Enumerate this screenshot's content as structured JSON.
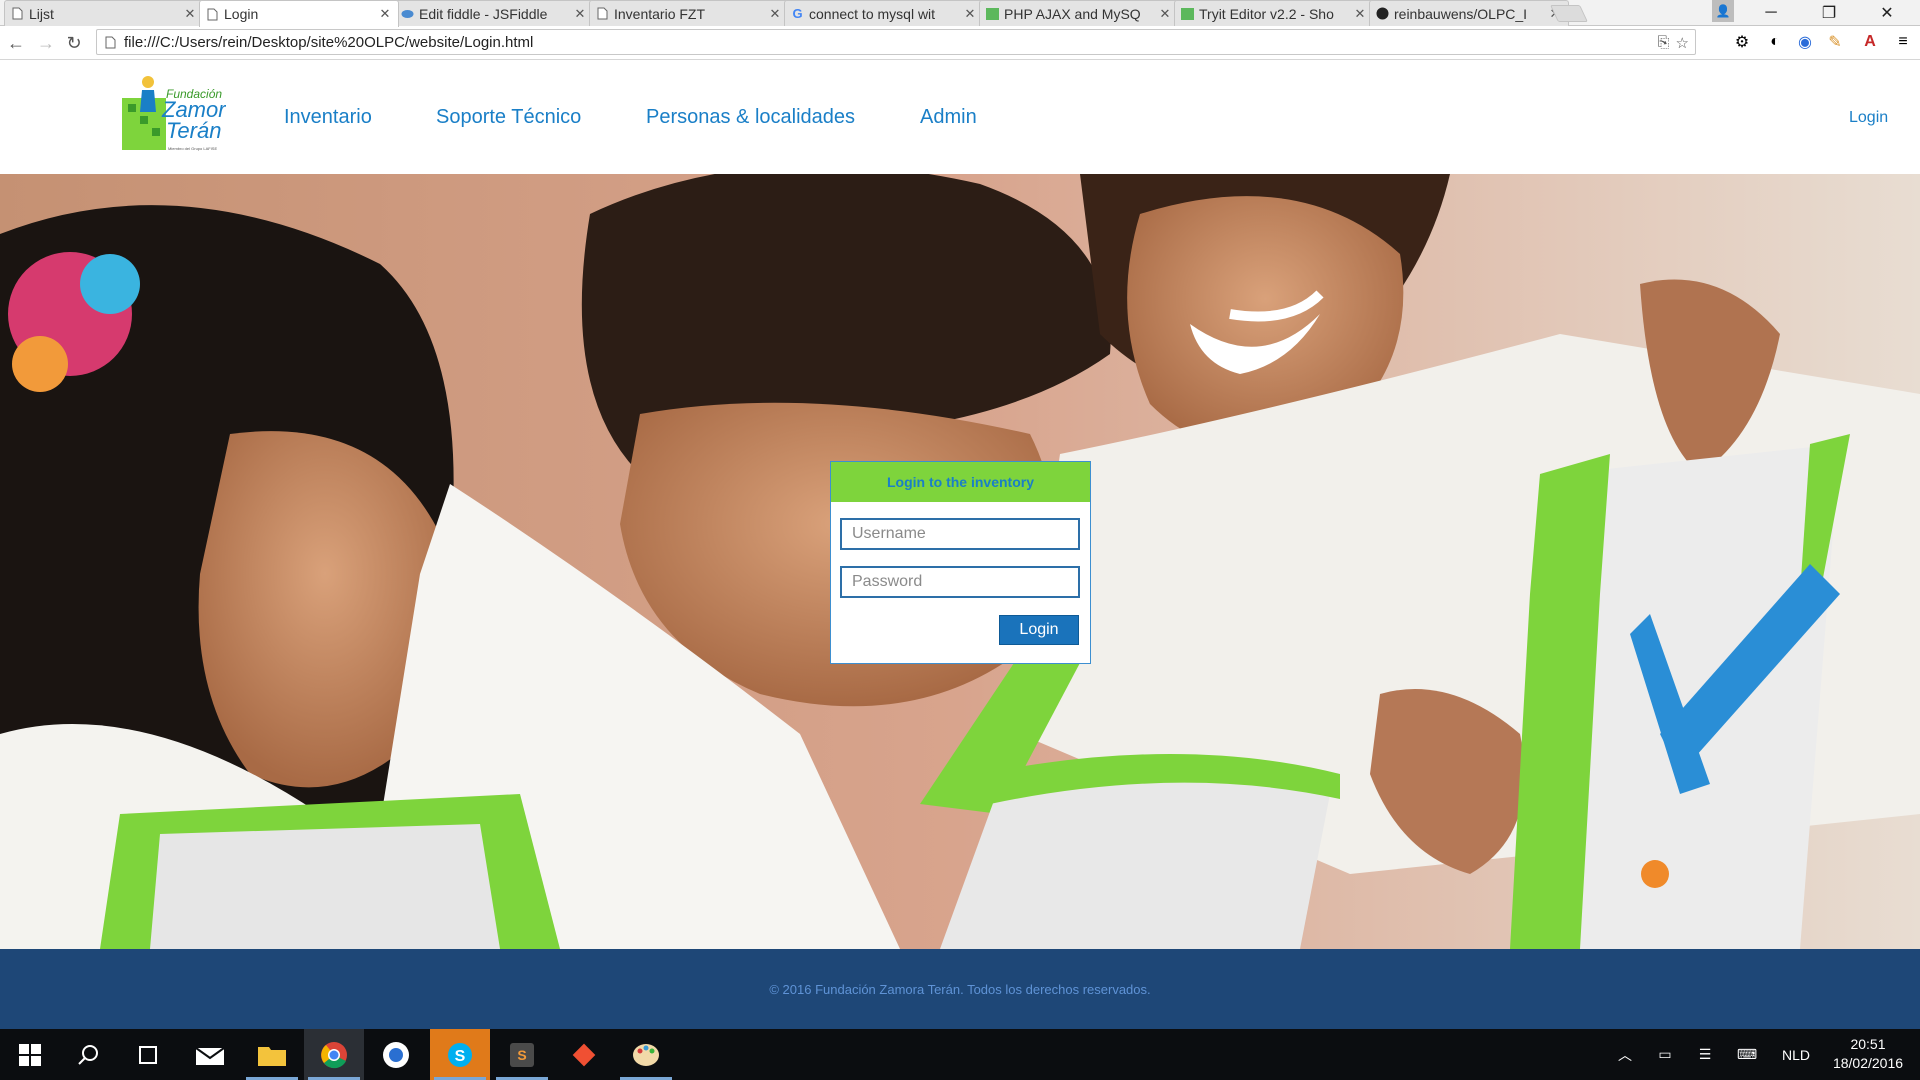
{
  "browser": {
    "tabs": [
      {
        "title": "Lijst",
        "icon": "page-icon"
      },
      {
        "title": "Login",
        "icon": "page-icon",
        "active": true
      },
      {
        "title": "Edit fiddle - JSFiddle",
        "icon": "jsfiddle-icon"
      },
      {
        "title": "Inventario FZT",
        "icon": "page-icon"
      },
      {
        "title": "connect to mysql wit",
        "icon": "google-icon"
      },
      {
        "title": "PHP AJAX and MySQ",
        "icon": "w3schools-icon"
      },
      {
        "title": "Tryit Editor v2.2 - Sho",
        "icon": "w3schools-icon"
      },
      {
        "title": "reinbauwens/OLPC_I",
        "icon": "github-icon"
      }
    ],
    "address": "file:///C:/Users/rein/Desktop/site%20OLPC/website/Login.html"
  },
  "site": {
    "logo": {
      "line1": "Fundación",
      "line2": "Zamora",
      "line3": "Terán",
      "tagline": "Miembro del Grupo LAFISE"
    },
    "nav": [
      "Inventario",
      "Soporte Técnico",
      "Personas & localidades",
      "Admin"
    ],
    "login_link": "Login"
  },
  "login": {
    "title": "Login to the inventory",
    "username_placeholder": "Username",
    "password_placeholder": "Password",
    "button": "Login"
  },
  "footer": {
    "text": "© 2016 Fundación Zamora Terán. Todos los derechos reservados."
  },
  "taskbar": {
    "apps": [
      "start-icon",
      "search-icon",
      "task-view-icon",
      "mail-icon",
      "file-explorer-icon",
      "chrome-icon",
      "browser-icon",
      "skype-icon",
      "sublime-text-icon",
      "git-icon",
      "paint-icon"
    ],
    "language": "NLD",
    "time": "20:51",
    "date": "18/02/2016"
  },
  "colors": {
    "nav_link": "#1a7fc7",
    "login_header": "#7ed43c",
    "login_button": "#1a73bb",
    "footer_bg": "#1e4777",
    "footer_text": "#5f93d6"
  }
}
